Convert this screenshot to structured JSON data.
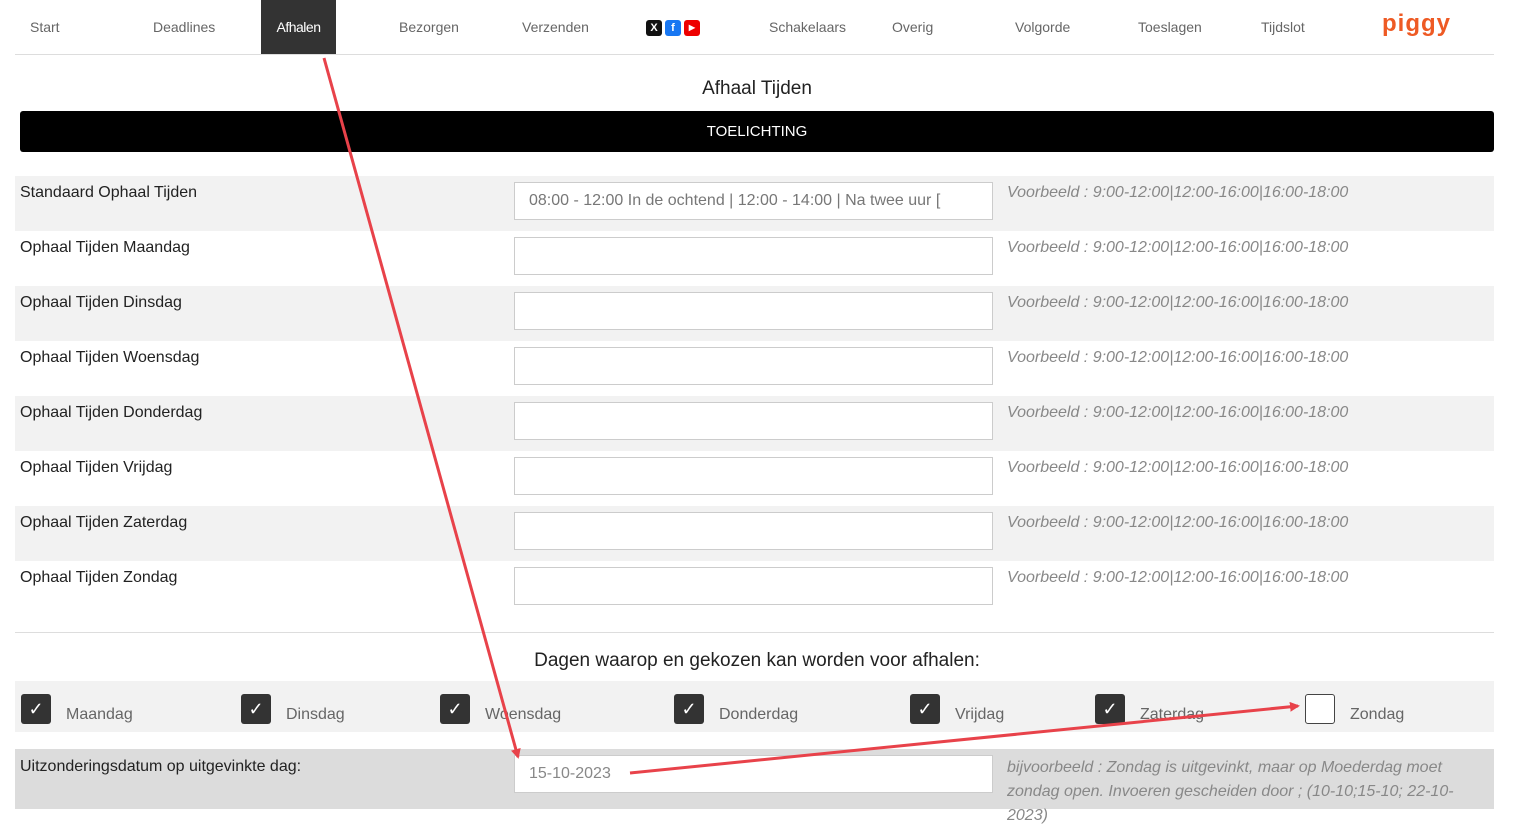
{
  "nav": {
    "items": [
      {
        "label": "Start"
      },
      {
        "label": "Deadlines"
      },
      {
        "label": "Afhalen",
        "active": true
      },
      {
        "label": "Bezorgen"
      },
      {
        "label": "Verzenden"
      },
      {
        "label": "Schakelaars"
      },
      {
        "label": "Overig"
      },
      {
        "label": "Volgorde"
      },
      {
        "label": "Toeslagen"
      },
      {
        "label": "Tijdslot"
      }
    ],
    "social_icons": [
      "x-icon",
      "facebook-icon",
      "youtube-icon"
    ],
    "logo": "piggy",
    "logo_color": "#ee5a24"
  },
  "page_title": "Afhaal Tijden",
  "banner": {
    "label": "TOELICHTING"
  },
  "rows": [
    {
      "label": "Standaard Ophaal Tijden",
      "value": "08:00 - 12:00 In de ochtend | 12:00 - 14:00 | Na twee uur [",
      "hint": "Voorbeeld : 9:00-12:00|12:00-16:00|16:00-18:00"
    },
    {
      "label": "Ophaal Tijden Maandag",
      "value": "",
      "hint": "Voorbeeld : 9:00-12:00|12:00-16:00|16:00-18:00"
    },
    {
      "label": "Ophaal Tijden Dinsdag",
      "value": "",
      "hint": "Voorbeeld : 9:00-12:00|12:00-16:00|16:00-18:00"
    },
    {
      "label": "Ophaal Tijden Woensdag",
      "value": "",
      "hint": "Voorbeeld : 9:00-12:00|12:00-16:00|16:00-18:00"
    },
    {
      "label": "Ophaal Tijden Donderdag",
      "value": "",
      "hint": "Voorbeeld : 9:00-12:00|12:00-16:00|16:00-18:00"
    },
    {
      "label": "Ophaal Tijden Vrijdag",
      "value": "",
      "hint": "Voorbeeld : 9:00-12:00|12:00-16:00|16:00-18:00"
    },
    {
      "label": "Ophaal Tijden Zaterdag",
      "value": "",
      "hint": "Voorbeeld : 9:00-12:00|12:00-16:00|16:00-18:00"
    },
    {
      "label": "Ophaal Tijden Zondag",
      "value": "",
      "hint": "Voorbeeld : 9:00-12:00|12:00-16:00|16:00-18:00"
    }
  ],
  "days_title": "Dagen waarop en gekozen kan worden voor afhalen:",
  "days": [
    {
      "label": "Maandag",
      "checked": true
    },
    {
      "label": "Dinsdag",
      "checked": true
    },
    {
      "label": "Woensdag",
      "checked": true
    },
    {
      "label": "Donderdag",
      "checked": true
    },
    {
      "label": "Vrijdag",
      "checked": true
    },
    {
      "label": "Zaterdag",
      "checked": true
    },
    {
      "label": "Zondag",
      "checked": false
    }
  ],
  "exception": {
    "label": "Uitzonderingsdatum op uitgevinkte dag:",
    "value": "15-10-2023",
    "hint": "bijvoorbeeld : Zondag is uitgevinkt, maar op Moederdag moet zondag open. Invoeren gescheiden door ; (10-10;15-10; 22-10-2023)"
  },
  "annotation_color": "#e8424a"
}
